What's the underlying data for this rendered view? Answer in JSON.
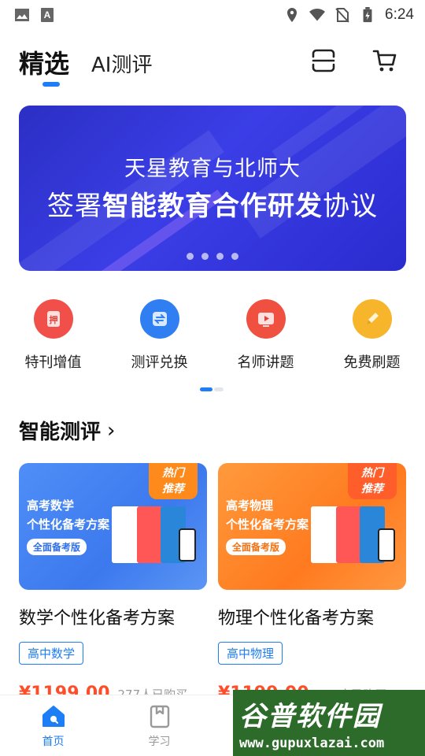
{
  "status_bar": {
    "time": "6:24"
  },
  "header": {
    "tab_active": "精选",
    "tab_other": "AI测评"
  },
  "banner": {
    "line1": "天星教育与北师大",
    "line2_pre": "签署",
    "line2_bold": "智能教育合作研发",
    "line2_post": "协议",
    "dot_count": 4
  },
  "quick_actions": [
    {
      "label": "特刊增值",
      "icon": "stamp-icon",
      "color": "#f1504a"
    },
    {
      "label": "测评兑换",
      "icon": "exchange-icon",
      "color": "#2f7ff2"
    },
    {
      "label": "名师讲题",
      "icon": "play-icon",
      "color": "#f05040"
    },
    {
      "label": "免费刷题",
      "icon": "pencil-icon",
      "color": "#f7b52c"
    }
  ],
  "section": {
    "title": "智能测评",
    "arrow": "›"
  },
  "products": [
    {
      "image_title_1": "高考数学",
      "image_title_2": "个性化备考方案",
      "image_pill": "全面备考版",
      "hot_1": "热门",
      "hot_2": "推荐",
      "title": "数学个性化备考方案",
      "tag": "高中数学",
      "price": "¥1199.00",
      "buyers": "277人已购买"
    },
    {
      "image_title_1": "高考物理",
      "image_title_2": "个性化备考方案",
      "image_pill": "全面备考版",
      "hot_1": "热门",
      "hot_2": "推荐",
      "title": "物理个性化备考方案",
      "tag": "高中物理",
      "price": "¥1199.00",
      "buyers": "154人已购买"
    }
  ],
  "bottom_nav": [
    {
      "label": "首页",
      "icon": "home-icon",
      "active": true
    },
    {
      "label": "学习",
      "icon": "book-icon",
      "active": false
    }
  ],
  "watermark": {
    "text": "谷普软件园",
    "url": "www.gupuxlazai.com"
  },
  "colors": {
    "accent": "#1e7ef5",
    "price": "#ff4d2a"
  }
}
